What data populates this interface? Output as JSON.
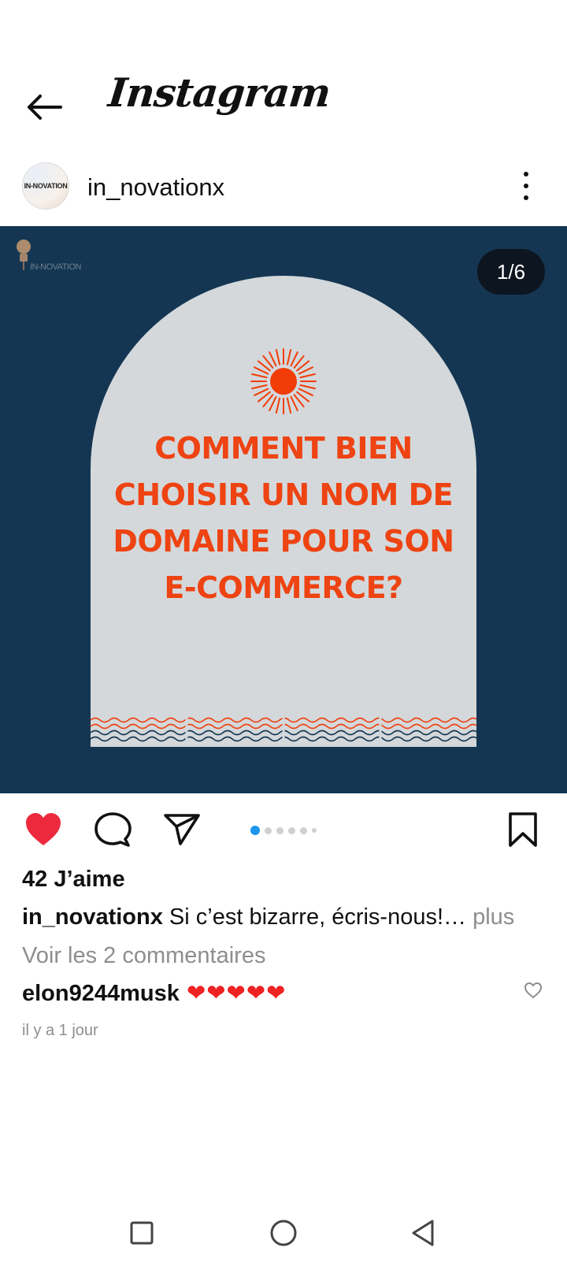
{
  "app": {
    "title": "Instagram"
  },
  "post": {
    "username": "in_novationx",
    "avatar_text": "IN-NOVATION",
    "image": {
      "logo_text": "IN-NOVATION",
      "counter": "1/6",
      "headline": [
        "COMMENT BIEN",
        "CHOISIR UN NOM DE",
        "DOMAINE POUR SON",
        "E-COMMERCE?"
      ],
      "colors": {
        "background": "#143652",
        "arch": "#d4d8db",
        "headline": "#ee4312"
      }
    },
    "carousel": {
      "total": 6,
      "active": 1
    },
    "likes": "42 J’aime",
    "caption": {
      "user": "in_novationx",
      "text": " Si c’est bizarre, écris-nous!…",
      "more": " plus"
    },
    "view_comments": "Voir les 2 commentaires",
    "comment": {
      "user": "elon9244musk",
      "text": " ❤❤❤❤❤"
    },
    "time": "il y a 1 jour"
  },
  "icons": {
    "back": "arrow-left-icon",
    "more": "more-vertical-icon",
    "like": "heart-filled-icon",
    "comment": "comment-icon",
    "share": "send-icon",
    "save": "bookmark-icon",
    "nav": [
      "square-icon",
      "circle-icon",
      "triangle-back-icon"
    ]
  },
  "colors": {
    "accent": "#1f95ec",
    "like": "#ed2a3d",
    "muted": "#8e8e8e"
  }
}
